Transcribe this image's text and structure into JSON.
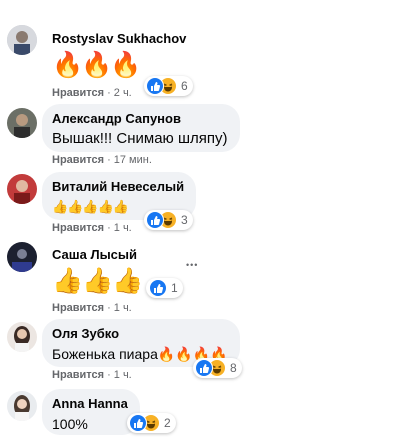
{
  "comments": [
    {
      "name": "Rostyslav Sukhachov",
      "text": "🔥🔥🔥",
      "like_label": "Нравится",
      "time": "2 ч.",
      "reaction_count": "6"
    },
    {
      "name": "Александр Сапунов",
      "text": "Вышак!!! Снимаю шляпу)",
      "like_label": "Нравится",
      "time": "17 мин."
    },
    {
      "name": "Виталий Невеселый",
      "text": "👍👍👍👍👍",
      "like_label": "Нравится",
      "time": "1 ч.",
      "reaction_count": "3"
    },
    {
      "name": "Саша Лысый",
      "text": "👍👍👍",
      "like_label": "Нравится",
      "time": "1 ч.",
      "reaction_count": "1",
      "more": "•••"
    },
    {
      "name": "Оля Зубко",
      "text": "Боженька пиара🔥🔥🔥🔥",
      "like_label": "Нравится",
      "time": "1 ч.",
      "reaction_count": "8"
    },
    {
      "name": "Anna Hanna",
      "text": "100%",
      "reaction_count": "2"
    }
  ],
  "colors": {
    "link_blue": "#1877f2",
    "haha_yellow": "#f7b125",
    "bubble_gray": "#f0f2f5",
    "meta_gray": "#65676b"
  },
  "icons": {
    "like": "thumbs-up-icon",
    "haha": "laughing-face-icon"
  }
}
